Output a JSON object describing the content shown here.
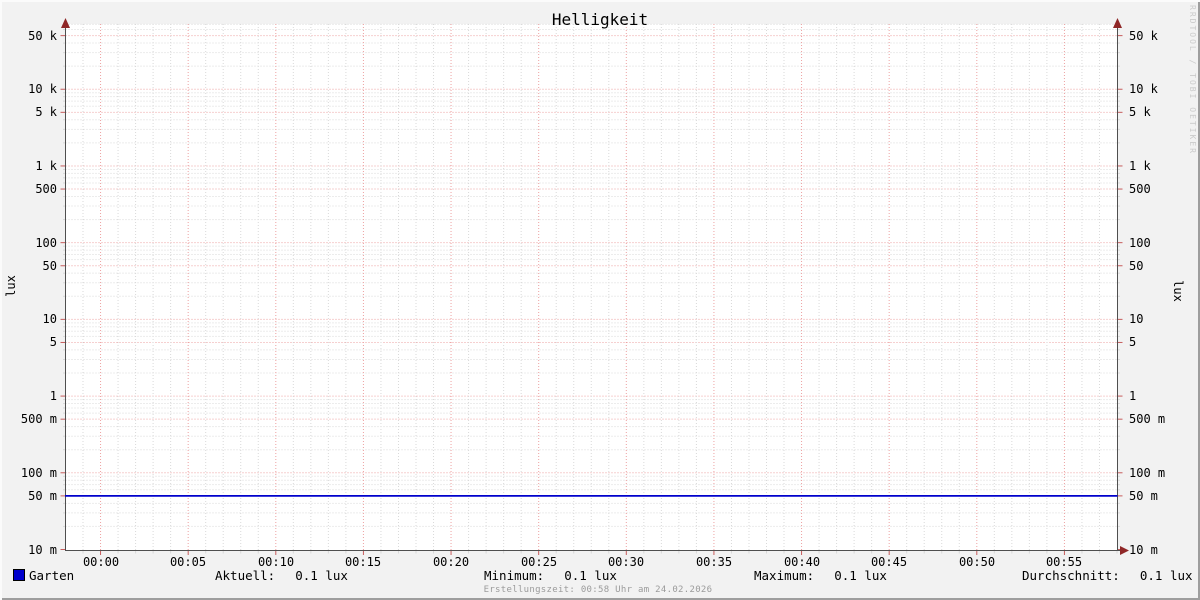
{
  "colors": {
    "background": "#f2f2f2",
    "canvas": "#ffffff",
    "grid_major": "#eda2a2",
    "grid_minor": "#d9d9d9",
    "axis": "#4f4f4f",
    "arrow": "#8f2727",
    "tick_major": "#c75c5c",
    "series": "#0000cc",
    "watermark": "#cbcbcb",
    "footer_text": "#9b9b9b"
  },
  "branding": {
    "watermark": "RRDTOOL / TOBI OETIKER"
  },
  "footer": {
    "created_text": "Erstellungszeit: 00:58 Uhr am 24.02.2026"
  },
  "legend": {
    "series_label": "Garten",
    "stats": [
      {
        "key": "aktuell",
        "label": "Aktuell:",
        "value": "0.1 lux"
      },
      {
        "key": "minimum",
        "label": "Minimum:",
        "value": "0.1 lux"
      },
      {
        "key": "maximum",
        "label": "Maximum:",
        "value": "0.1 lux"
      },
      {
        "key": "durchschnitt",
        "label": "Durchschnitt:",
        "value": "0.1 lux"
      }
    ]
  },
  "chart_data": {
    "type": "line",
    "title": "Helligkeit",
    "ylabel": "lux",
    "ylabel_right": "lux",
    "y_scale": "logarithmic",
    "y_range": [
      0.01,
      70000
    ],
    "grid": "on",
    "legend_position": "bottom",
    "y_tick_labels": [
      {
        "value": 50000,
        "label": "50 k"
      },
      {
        "value": 10000,
        "label": "10 k"
      },
      {
        "value": 5000,
        "label": "5 k"
      },
      {
        "value": 1000,
        "label": "1 k"
      },
      {
        "value": 500,
        "label": "500"
      },
      {
        "value": 100,
        "label": "100"
      },
      {
        "value": 50,
        "label": "50"
      },
      {
        "value": 10,
        "label": "10"
      },
      {
        "value": 5,
        "label": "5"
      },
      {
        "value": 1,
        "label": "1"
      },
      {
        "value": 0.5,
        "label": "500 m"
      },
      {
        "value": 0.1,
        "label": "100 m"
      },
      {
        "value": 0.05,
        "label": "50 m"
      },
      {
        "value": 0.01,
        "label": "10 m"
      }
    ],
    "x_axis": {
      "unit": "time",
      "start_offset_min": -2,
      "end_offset_min": 58,
      "minor_step_min": 1,
      "major_step_min": 5
    },
    "x_ticks": [
      {
        "t": 0,
        "label": "00:00"
      },
      {
        "t": 5,
        "label": "00:05"
      },
      {
        "t": 10,
        "label": "00:10"
      },
      {
        "t": 15,
        "label": "00:15"
      },
      {
        "t": 20,
        "label": "00:20"
      },
      {
        "t": 25,
        "label": "00:25"
      },
      {
        "t": 30,
        "label": "00:30"
      },
      {
        "t": 35,
        "label": "00:35"
      },
      {
        "t": 40,
        "label": "00:40"
      },
      {
        "t": 45,
        "label": "00:45"
      },
      {
        "t": 50,
        "label": "00:50"
      },
      {
        "t": 55,
        "label": "00:55"
      }
    ],
    "series": [
      {
        "name": "Garten",
        "color": "#0000cc",
        "shape": "constant-horizontal-line",
        "reported_value_lux": "0.1",
        "line_level_lux": 0.05
      }
    ]
  }
}
